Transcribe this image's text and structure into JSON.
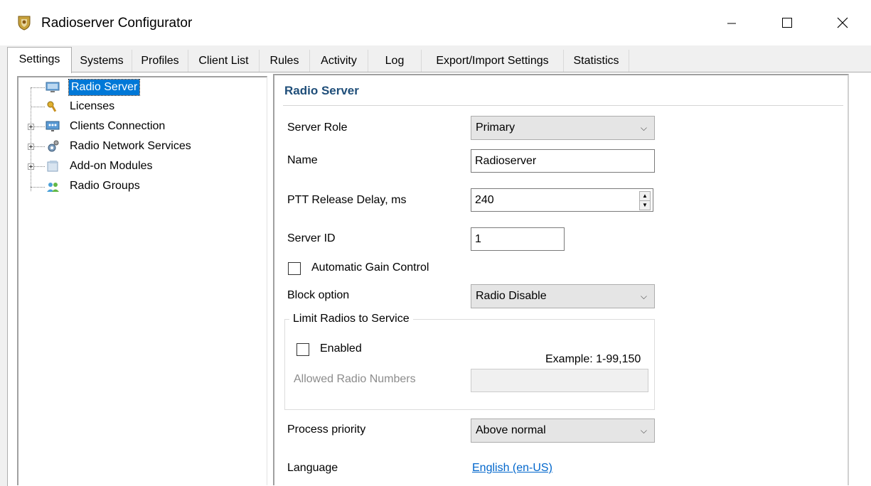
{
  "window": {
    "title": "Radioserver Configurator",
    "controls": {
      "minimize": "minimize-icon",
      "maximize": "maximize-icon",
      "close": "close-icon"
    }
  },
  "tabs": [
    {
      "label": "Settings",
      "active": true
    },
    {
      "label": "Systems"
    },
    {
      "label": "Profiles"
    },
    {
      "label": "Client List"
    },
    {
      "label": "Rules"
    },
    {
      "label": "Activity"
    },
    {
      "label": "Log"
    },
    {
      "label": "Export/Import Settings"
    },
    {
      "label": "Statistics"
    }
  ],
  "tree": {
    "items": [
      {
        "label": "Radio Server",
        "icon": "server-icon",
        "selected": true
      },
      {
        "label": "Licenses",
        "icon": "license-key-icon"
      },
      {
        "label": "Clients Connection",
        "icon": "network-icon",
        "expandable": true
      },
      {
        "label": "Radio Network Services",
        "icon": "services-gear-icon",
        "expandable": true
      },
      {
        "label": "Add-on Modules",
        "icon": "modules-icon",
        "expandable": true
      },
      {
        "label": "Radio Groups",
        "icon": "groups-icon"
      }
    ]
  },
  "panel": {
    "title": "Radio Server",
    "server_role": {
      "label": "Server Role",
      "value": "Primary"
    },
    "name": {
      "label": "Name",
      "value": "Radioserver"
    },
    "ptt_release_delay": {
      "label": "PTT Release Delay, ms",
      "value": "240"
    },
    "server_id": {
      "label": "Server ID",
      "value": "1"
    },
    "agc": {
      "label": "Automatic Gain Control",
      "checked": false
    },
    "block_option": {
      "label": "Block option",
      "value": "Radio Disable"
    },
    "limit_group": {
      "label": "Limit Radios to Service",
      "enabled": {
        "label": "Enabled",
        "checked": false
      },
      "example": "Example: 1-99,150",
      "allowed": {
        "label": "Allowed Radio Numbers",
        "value": ""
      }
    },
    "process_priority": {
      "label": "Process priority",
      "value": "Above normal"
    },
    "language": {
      "label": "Language",
      "value": "English (en-US)"
    }
  },
  "colors": {
    "selection": "#0078d7",
    "title": "#1f4e79",
    "link": "#0066cc"
  }
}
